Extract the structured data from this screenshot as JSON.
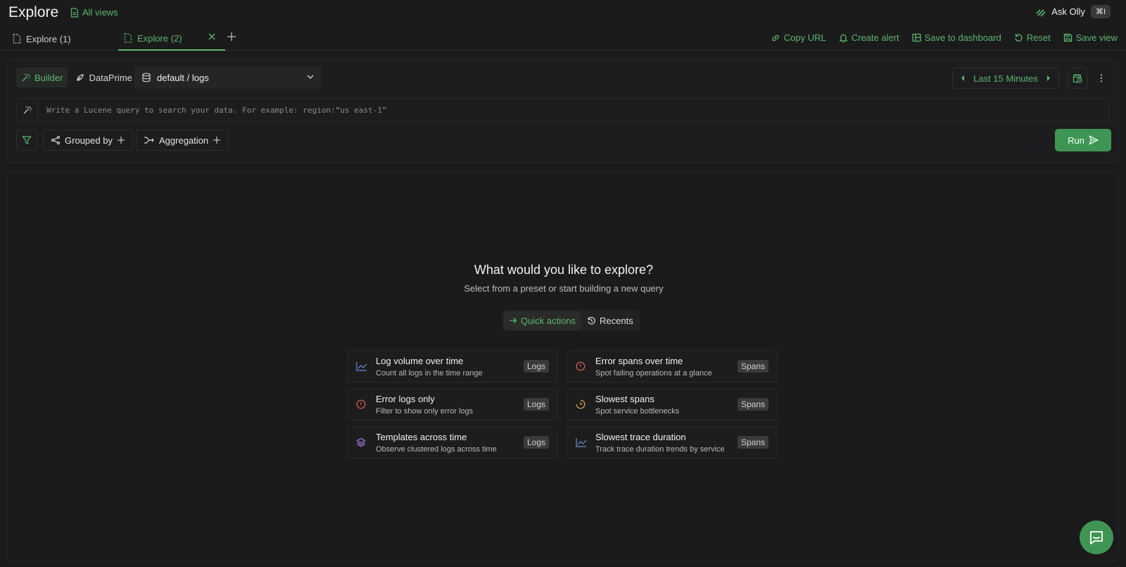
{
  "header": {
    "title": "Explore",
    "all_views_label": "All views",
    "ask_olly_label": "Ask Olly",
    "ask_olly_shortcut": "⌘I"
  },
  "tabs": [
    {
      "label": "Explore (1)",
      "active": false
    },
    {
      "label": "Explore (2)",
      "active": true
    }
  ],
  "actions": {
    "copy_url": "Copy URL",
    "create_alert": "Create alert",
    "save_to_dashboard": "Save to dashboard",
    "reset": "Reset",
    "save_view": "Save view"
  },
  "query": {
    "modes": [
      "Builder",
      "DataPrime"
    ],
    "active_mode": "Builder",
    "dataset": "default / logs",
    "time_range": "Last 15 Minutes",
    "placeholder": "Write a Lucene query to search your data. For example: region:“us east-1”",
    "grouped_by_label": "Grouped by",
    "aggregation_label": "Aggregation",
    "run_label": "Run"
  },
  "empty_state": {
    "title": "What would you like to explore?",
    "subtitle": "Select from a preset or start building a new query",
    "segments": [
      "Quick actions",
      "Recents"
    ],
    "active_segment": "Quick actions"
  },
  "presets": [
    {
      "title": "Log volume over time",
      "description": "Count all logs in the time range",
      "badge": "Logs",
      "icon": "line-chart-icon",
      "color": "#6f8fd8"
    },
    {
      "title": "Error spans over time",
      "description": "Spot failing operations at a glance",
      "badge": "Spans",
      "icon": "error-circle-icon",
      "color": "#e05a5a"
    },
    {
      "title": "Error logs only",
      "description": "Filter to show only error logs",
      "badge": "Logs",
      "icon": "error-circle-icon",
      "color": "#e05a5a"
    },
    {
      "title": "Slowest spans",
      "description": "Spot service bottlenecks",
      "badge": "Spans",
      "icon": "clock-icon",
      "color": "#e0a04a"
    },
    {
      "title": "Templates across time",
      "description": "Observe clustered logs across time",
      "badge": "Logs",
      "icon": "layers-icon",
      "color": "#a07ae0"
    },
    {
      "title": "Slowest trace duration",
      "description": "Track trace duration trends by service",
      "badge": "Spans",
      "icon": "line-chart-icon",
      "color": "#6f8fd8"
    }
  ],
  "colors": {
    "accent": "#5cb56e",
    "run_button": "#3f9654",
    "background": "#1b1b1c"
  }
}
